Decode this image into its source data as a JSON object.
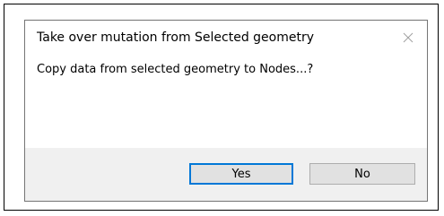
{
  "dialog": {
    "title": "Take over mutation from Selected geometry",
    "message": "Copy data from selected geometry to Nodes...?",
    "close_icon": "close-icon",
    "buttons": {
      "yes_label": "Yes",
      "no_label": "No"
    }
  },
  "colors": {
    "dialog_background": "#ffffff",
    "footer_background": "#f0f0f0",
    "button_background": "#e1e1e1",
    "default_button_focus": "#0078d7",
    "close_icon": "#a0a0a0"
  }
}
